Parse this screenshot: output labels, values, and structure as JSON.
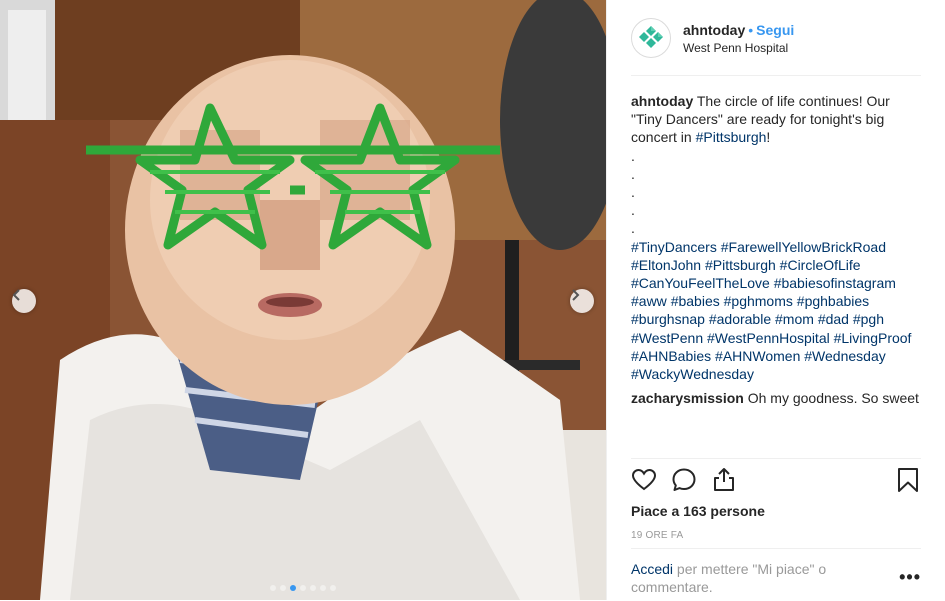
{
  "post": {
    "username": "ahntoday",
    "separator": "•",
    "follow_label": "Segui",
    "location": "West Penn Hospital",
    "photo_alt": "Baby wrapped in a white blanket wearing green star-shaped shutter glasses"
  },
  "caption": {
    "username": "ahntoday",
    "text_before": " The circle of life continues! Our \"Tiny Dancers\" are ready for tonight's big concert in ",
    "inline_hashtag": "#Pittsburgh",
    "text_after": "!",
    "dots": [
      ".",
      ".",
      ".",
      ".",
      "."
    ],
    "hashtags": [
      "#TinyDancers",
      "#FarewellYellowBrickRoad",
      "#EltonJohn",
      "#Pittsburgh",
      "#CircleOfLife",
      "#CanYouFeelTheLove",
      "#babiesofinstagram",
      "#aww",
      "#babies",
      "#pghmoms",
      "#pghbabies",
      "#burghsnap",
      "#adorable",
      "#mom",
      "#dad",
      "#pgh",
      "#WestPenn",
      "#WestPennHospital",
      "#LivingProof",
      "#AHNBabies",
      "#AHNWomen",
      "#Wednesday",
      "#WackyWednesday"
    ]
  },
  "comment": {
    "username": "zacharysmission",
    "text": " Oh my goodness. So sweet"
  },
  "actions": {
    "like_icon": "heart-icon",
    "comment_icon": "speech-bubble-icon",
    "share_icon": "share-icon",
    "save_icon": "bookmark-icon"
  },
  "likes_text": "Piace a 163 persone",
  "timestamp": "19 ORE FA",
  "login": {
    "link_text": "Accedi",
    "rest_text": " per mettere \"Mi piace\" o commentare."
  },
  "more_label": "•••",
  "carousel": {
    "dot_count": 7,
    "active_index": 2
  },
  "colors": {
    "link_blue": "#3897f0",
    "hashtag_navy": "#003569",
    "text": "#262626",
    "muted": "#999999",
    "brand_green": "#2fb89a"
  }
}
